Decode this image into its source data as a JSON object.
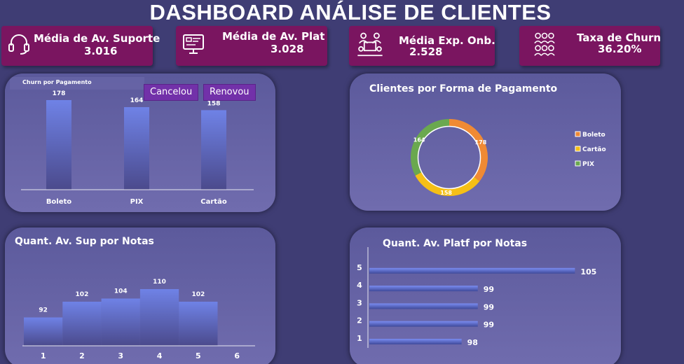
{
  "header": {
    "title": "DASHBOARD ANÁLISE DE CLIENTES"
  },
  "kpis": [
    {
      "label": "Média de Av. Suporte",
      "value": "3.016",
      "icon": "headset-icon"
    },
    {
      "label": "Média de Av. Plat",
      "value": "3.028",
      "icon": "platform-screen-icon"
    },
    {
      "label": "Média Exp. Onb.",
      "value": "2.528",
      "icon": "onboarding-meeting-icon"
    },
    {
      "label": "Taxa de Churn",
      "value": "36.20%",
      "icon": "customers-group-icon"
    }
  ],
  "churn_panel": {
    "subtitle": "Churn por Pagamento",
    "buttons": [
      "Cancelou",
      "Renovou"
    ]
  },
  "payment_panel": {
    "title": "Clientes por Forma de Pagamento"
  },
  "support_panel": {
    "title": "Quant. Av. Sup por Notas"
  },
  "platform_panel": {
    "title": "Quant. Av. Platf por Notas"
  },
  "colors": {
    "kpi_bg": "#7a1560",
    "bar_top": "#6f82e6",
    "bar_bottom": "#4b4a8c",
    "boleto": "#f08a34",
    "cartao": "#f5bf16",
    "pix": "#6aa84f",
    "button": "#7231a9"
  },
  "chart_data": [
    {
      "type": "bar",
      "title": "Churn por Pagamento",
      "categories": [
        "Boleto",
        "PIX",
        "Cartão"
      ],
      "values": [
        178,
        164,
        158
      ]
    },
    {
      "type": "pie",
      "title": "Clientes por Forma de Pagamento",
      "categories": [
        "Boleto",
        "Cartão",
        "PIX"
      ],
      "values": [
        178,
        158,
        164
      ],
      "legend": "right"
    },
    {
      "type": "bar",
      "title": "Quant. Av. Sup por Notas",
      "categories": [
        "1",
        "2",
        "3",
        "4",
        "5",
        "6"
      ],
      "values": [
        92,
        102,
        104,
        110,
        102,
        null
      ]
    },
    {
      "type": "bar",
      "orientation": "horizontal",
      "title": "Quant. Av. Platf por Notas",
      "categories": [
        "1",
        "2",
        "3",
        "4",
        "5"
      ],
      "values": [
        98,
        99,
        99,
        99,
        105
      ]
    }
  ]
}
